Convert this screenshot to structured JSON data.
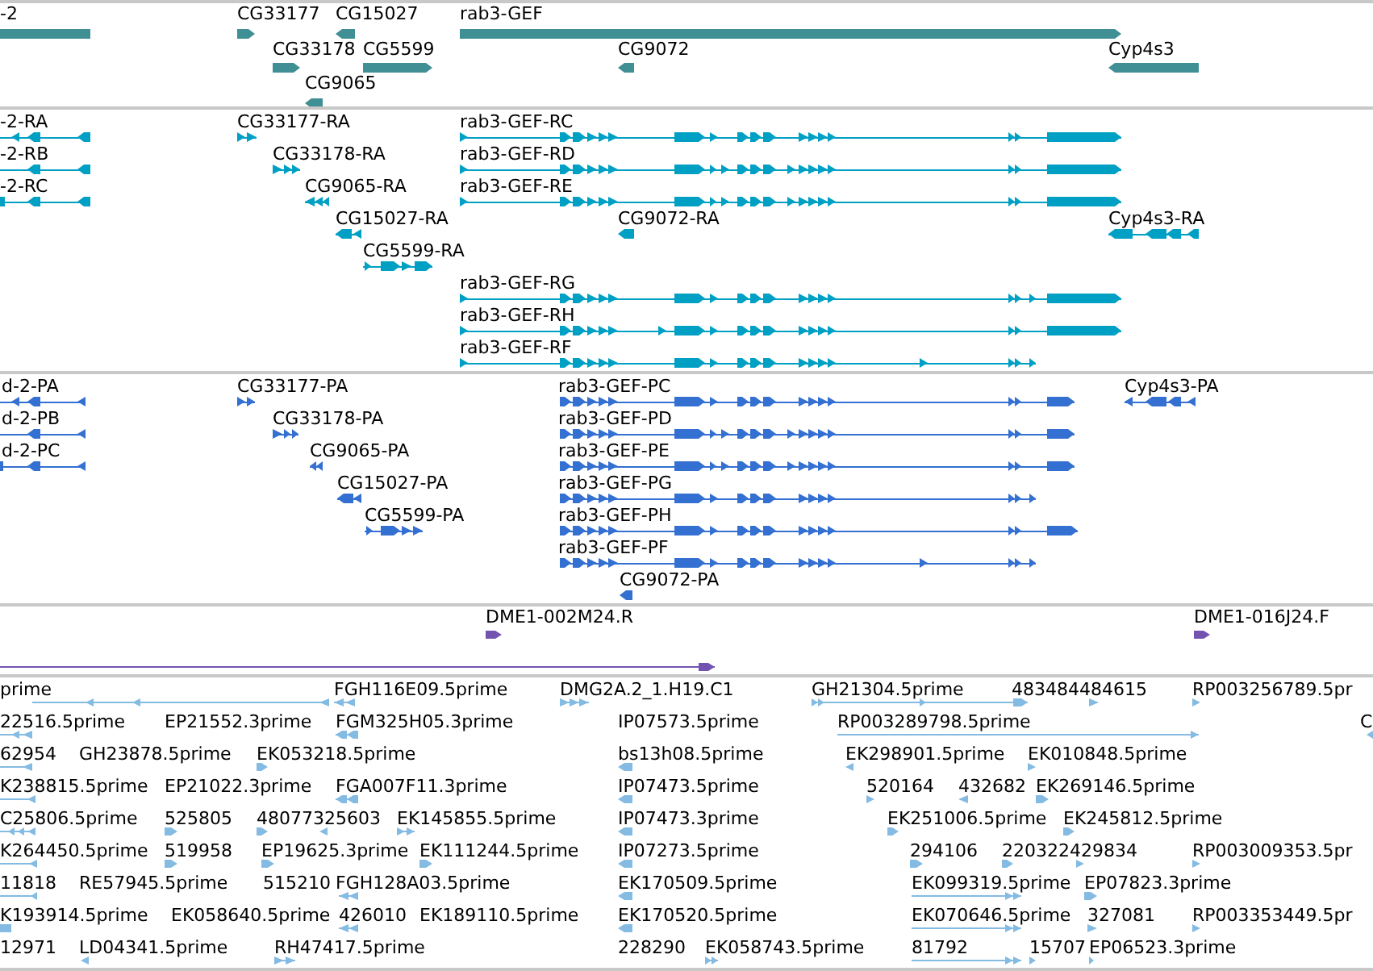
{
  "tracks": [
    {
      "kind": "gene",
      "rows": [
        {
          "features": [
            {
              "label": "-2",
              "reverse": true
            },
            {
              "label": "CG33177",
              "reverse": false
            },
            {
              "label": "CG15027",
              "reverse": true
            },
            {
              "label": "rab3-GEF",
              "reverse": false
            }
          ]
        },
        {
          "features": [
            {
              "label": "CG33178",
              "reverse": false
            },
            {
              "label": "CG5599",
              "reverse": false
            },
            {
              "label": "CG9072",
              "reverse": true
            },
            {
              "label": "Cyp4s3",
              "reverse": true
            }
          ]
        },
        {
          "features": [
            {
              "label": "CG9065",
              "reverse": true
            }
          ]
        }
      ]
    },
    {
      "kind": "transcript",
      "rows": [
        {
          "features": [
            {
              "label": "-2-RA",
              "reverse": true
            },
            {
              "label": "CG33177-RA",
              "reverse": false
            },
            {
              "label": "rab3-GEF-RC",
              "reverse": false
            }
          ]
        },
        {
          "features": [
            {
              "label": "-2-RB",
              "reverse": true
            },
            {
              "label": "CG33178-RA",
              "reverse": false
            },
            {
              "label": "rab3-GEF-RD",
              "reverse": false
            }
          ]
        },
        {
          "features": [
            {
              "label": "-2-RC",
              "reverse": true
            },
            {
              "label": "CG9065-RA",
              "reverse": true
            },
            {
              "label": "rab3-GEF-RE",
              "reverse": false
            }
          ]
        },
        {
          "features": [
            {
              "label": "CG15027-RA",
              "reverse": true
            },
            {
              "label": "CG9072-RA",
              "reverse": true
            },
            {
              "label": "Cyp4s3-RA",
              "reverse": true
            }
          ]
        },
        {
          "features": [
            {
              "label": "CG5599-RA",
              "reverse": false
            }
          ]
        },
        {
          "features": [
            {
              "label": "rab3-GEF-RG",
              "reverse": false
            }
          ]
        },
        {
          "features": [
            {
              "label": "rab3-GEF-RH",
              "reverse": false
            }
          ]
        },
        {
          "features": [
            {
              "label": "rab3-GEF-RF",
              "reverse": false
            }
          ]
        }
      ]
    },
    {
      "kind": "protein",
      "rows": [
        {
          "features": [
            {
              "label": "d-2-PA",
              "reverse": true
            },
            {
              "label": "CG33177-PA",
              "reverse": false
            },
            {
              "label": "rab3-GEF-PC",
              "reverse": false
            },
            {
              "label": "Cyp4s3-PA",
              "reverse": true
            }
          ]
        },
        {
          "features": [
            {
              "label": "d-2-PB",
              "reverse": true
            },
            {
              "label": "CG33178-PA",
              "reverse": false
            },
            {
              "label": "rab3-GEF-PD",
              "reverse": false
            }
          ]
        },
        {
          "features": [
            {
              "label": "d-2-PC",
              "reverse": true
            },
            {
              "label": "CG9065-PA",
              "reverse": true
            },
            {
              "label": "rab3-GEF-PE",
              "reverse": false
            }
          ]
        },
        {
          "features": [
            {
              "label": "CG15027-PA",
              "reverse": true
            },
            {
              "label": "rab3-GEF-PG",
              "reverse": false
            }
          ]
        },
        {
          "features": [
            {
              "label": "CG5599-PA",
              "reverse": false
            },
            {
              "label": "rab3-GEF-PH",
              "reverse": false
            }
          ]
        },
        {
          "features": [
            {
              "label": "rab3-GEF-PF",
              "reverse": false
            }
          ]
        },
        {
          "features": [
            {
              "label": "CG9072-PA",
              "reverse": true
            }
          ]
        }
      ]
    },
    {
      "kind": "clone",
      "rows": [
        {
          "features": [
            {
              "label": "DME1-002M24.R",
              "reverse": false
            },
            {
              "label": "DME1-016J24.F",
              "reverse": false
            }
          ]
        },
        {
          "features": [
            {
              "reverse": false
            }
          ]
        }
      ]
    },
    {
      "kind": "est",
      "rows": [
        {
          "features": [
            {
              "label": "prime",
              "reverse": true
            },
            {
              "label": "FGH116E09.5prime",
              "reverse": true
            },
            {
              "label": "DMG2A.2_1.H19.C1",
              "reverse": false
            },
            {
              "label": "GH21304.5prime",
              "reverse": false
            },
            {
              "label": "483484484615"
            },
            {
              "reverse": false
            },
            {
              "label": "RP003256789.5pr",
              "reverse": false
            }
          ]
        },
        {
          "features": [
            {
              "label": "22516.5prime",
              "reverse": true
            },
            {
              "label": "EP21552.3prime"
            },
            {
              "label": "FGM325H05.3prime",
              "reverse": true
            },
            {
              "label": "IP07573.5prime"
            },
            {
              "label": "RP003289798.5prime",
              "reverse": false
            },
            {
              "label": "C",
              "reverse": true
            }
          ]
        },
        {
          "features": [
            {
              "label": "62954",
              "reverse": true
            },
            {
              "label": "GH23878.5prime"
            },
            {
              "label": "EK053218.5prime",
              "reverse": false
            },
            {
              "label": "bs13h08.5prime",
              "reverse": true
            },
            {
              "label": "EK298901.5prime",
              "reverse": true
            },
            {
              "label": "EK010848.5prime",
              "reverse": false
            }
          ]
        },
        {
          "features": [
            {
              "label": "K238815.5prime",
              "reverse": true
            },
            {
              "label": "EP21022.3prime"
            },
            {
              "label": "FGA007F11.3prime",
              "reverse": true
            },
            {
              "label": "IP07473.5prime",
              "reverse": true
            },
            {
              "label": "520164",
              "reverse": false
            },
            {
              "label": "432682",
              "reverse": true
            },
            {
              "label": "EK269146.5prime",
              "reverse": false
            }
          ]
        },
        {
          "features": [
            {
              "label": "C25806.5prime",
              "reverse": true
            },
            {
              "label": "525805",
              "reverse": false
            },
            {
              "label": "48077325603",
              "reverse": false
            },
            {
              "reverse": true
            },
            {
              "label": "EK145855.5prime",
              "reverse": false
            },
            {
              "label": "IP07473.3prime",
              "reverse": true
            },
            {
              "label": "EK251006.5prime",
              "reverse": false
            },
            {
              "label": "EK245812.5prime",
              "reverse": false
            }
          ]
        },
        {
          "features": [
            {
              "label": "K264450.5prime",
              "reverse": true
            },
            {
              "label": "519958",
              "reverse": false
            },
            {
              "label": "EP19625.3prime",
              "reverse": false
            },
            {
              "label": "EK111244.5prime",
              "reverse": false
            },
            {
              "label": "IP07273.5prime",
              "reverse": true
            },
            {
              "label": "294106",
              "reverse": false
            },
            {
              "label": "220322429834",
              "reverse": false
            },
            {
              "reverse": false
            },
            {
              "label": "RP003009353.5pr",
              "reverse": false
            }
          ]
        },
        {
          "features": [
            {
              "label": "11818",
              "reverse": true
            },
            {
              "label": "RE57945.5prime"
            },
            {
              "label": "515210"
            },
            {
              "label": "FGH128A03.5prime",
              "reverse": true
            },
            {
              "label": "EK170509.5prime",
              "reverse": true
            },
            {
              "label": "EK099319.5prime",
              "reverse": false
            },
            {
              "label": "EP07823.3prime",
              "reverse": false
            }
          ]
        },
        {
          "features": [
            {
              "label": "K193914.5prime",
              "reverse": true
            },
            {
              "label": "EK058640.5prime"
            },
            {
              "label": "426010",
              "reverse": true
            },
            {
              "label": "EK189110.5prime"
            },
            {
              "label": "EK170520.5prime",
              "reverse": true
            },
            {
              "label": "EK070646.5prime",
              "reverse": false
            },
            {
              "label": "327081",
              "reverse": false
            },
            {
              "label": "RP003353449.5pr",
              "reverse": false
            }
          ]
        },
        {
          "features": [
            {
              "label": "12971"
            },
            {
              "label": "LD04341.5prime",
              "reverse": true
            },
            {
              "label": "RH47417.5prime",
              "reverse": false
            },
            {
              "label": "228290"
            },
            {
              "label": "EK058743.5prime",
              "reverse": false
            },
            {
              "label": "81792",
              "reverse": false
            },
            {
              "label": "15707",
              "reverse": false
            },
            {
              "label": "EP06523.3prime",
              "reverse": false
            }
          ]
        }
      ]
    }
  ]
}
